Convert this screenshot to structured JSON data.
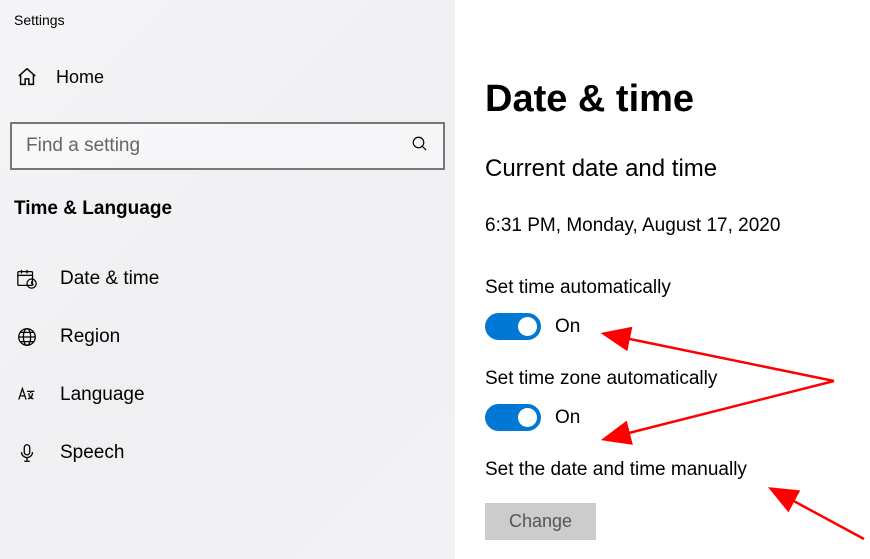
{
  "app_title": "Settings",
  "sidebar": {
    "home": "Home",
    "search_placeholder": "Find a setting",
    "category": "Time & Language",
    "items": [
      {
        "label": "Date & time"
      },
      {
        "label": "Region"
      },
      {
        "label": "Language"
      },
      {
        "label": "Speech"
      }
    ]
  },
  "main": {
    "heading": "Date & time",
    "section": "Current date and time",
    "datetime": "6:31 PM, Monday, August 17, 2020",
    "set_time_auto_label": "Set time automatically",
    "set_time_auto_state": "On",
    "set_zone_auto_label": "Set time zone automatically",
    "set_zone_auto_state": "On",
    "manual_label": "Set the date and time manually",
    "change_button": "Change"
  }
}
